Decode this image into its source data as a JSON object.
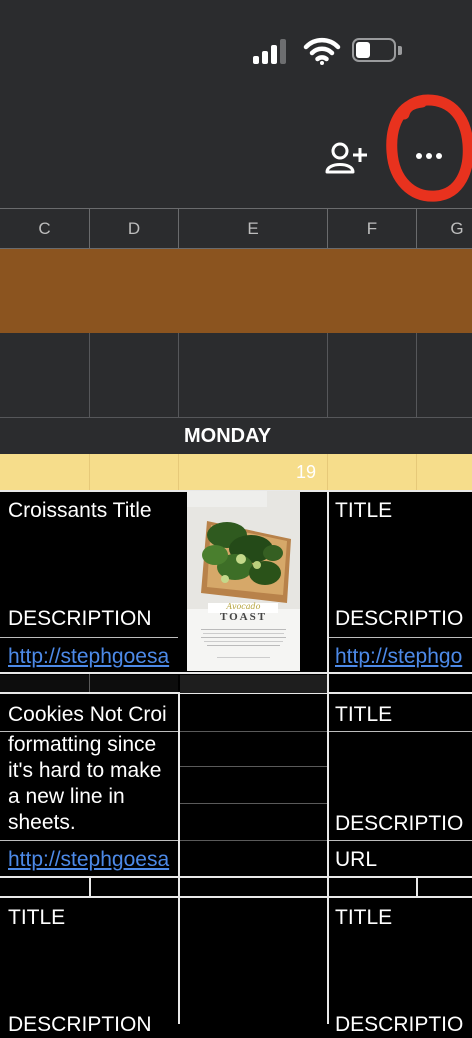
{
  "status_bar": {
    "icons": [
      "signal-icon",
      "wifi-icon",
      "battery-icon"
    ]
  },
  "toolbar": {
    "icons": [
      "add-person-icon",
      "more-options-icon"
    ],
    "annotation_color": "#e8321e"
  },
  "columns": [
    "C",
    "D",
    "E",
    "F",
    "G"
  ],
  "day_header": {
    "label": "MONDAY",
    "date": "19"
  },
  "colors": {
    "band": "#8b541f",
    "date_row": "#f6dd8b",
    "link": "#4d8ae8",
    "chrome": "#2b2c2e"
  },
  "rows": {
    "r1": {
      "left_title": "Croissants Title",
      "left_description": "DESCRIPTION",
      "left_url": "http://stephgoesa",
      "right_title": "TITLE",
      "right_description": "DESCRIPTIO",
      "right_url": "http://stephgo"
    },
    "r2": {
      "left_title": "Cookies Not Croi",
      "left_description_lines": [
        "formatting since",
        "it's hard to make",
        "a new line in",
        "sheets."
      ],
      "left_url": "http://stephgoesa",
      "right_title": "TITLE",
      "right_description": "DESCRIPTIO",
      "right_url": "URL"
    },
    "r3": {
      "left_title": "TITLE",
      "left_description": "DESCRIPTION",
      "right_title": "TITLE",
      "right_description": "DESCRIPTIO"
    }
  },
  "recipe_card": {
    "title_small": "Avocado",
    "title_big": "TOAST",
    "image": "avocado-toast-photo"
  }
}
